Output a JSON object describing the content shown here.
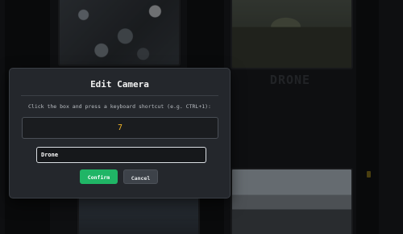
{
  "background": {
    "grid_label": "DRONE"
  },
  "modal": {
    "title": "Edit Camera",
    "hint": "Click the box and press a keyboard shortcut (e.g. CTRL+1):",
    "shortcut_value": "7",
    "name_value": "Drone",
    "confirm_label": "Confirm",
    "cancel_label": "Cancel"
  },
  "colors": {
    "accent_confirm": "#20b566",
    "shortcut_text": "#f0b429",
    "modal_bg": "#24272c"
  }
}
